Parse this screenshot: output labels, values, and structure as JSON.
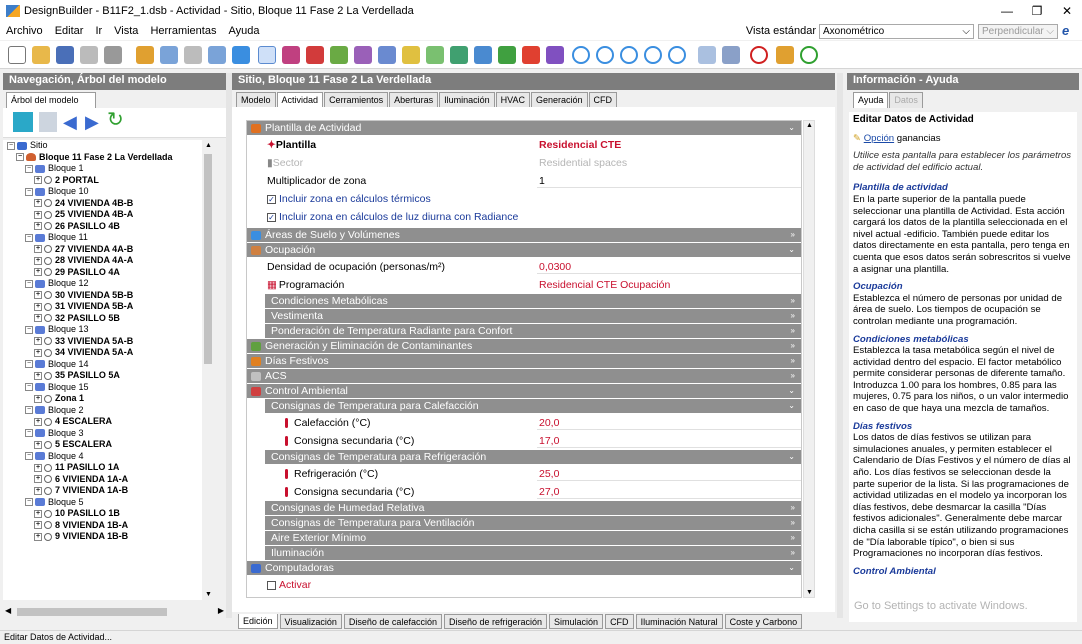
{
  "window": {
    "title": "DesignBuilder - B11F2_1.dsb - Actividad - Sitio, Bloque 11 Fase 2 La Verdellada"
  },
  "menu": {
    "items": [
      "Archivo",
      "Editar",
      "Ir",
      "Vista",
      "Herramientas",
      "Ayuda"
    ],
    "view_label": "Vista estándar",
    "view_mode": "Axonométrico",
    "view_direction": "Perpendicular"
  },
  "nav": {
    "title": "Navegación, Árbol del modelo",
    "tab": "Árbol del modelo",
    "tree": [
      {
        "label": "Sitio",
        "level": 0,
        "type": "site"
      },
      {
        "label": "Bloque 11 Fase 2 La Verdellada",
        "level": 1,
        "type": "building",
        "bold": true
      },
      {
        "label": "Bloque 1",
        "level": 2,
        "type": "block"
      },
      {
        "label": "2 PORTAL",
        "level": 3,
        "type": "zone",
        "bold": true
      },
      {
        "label": "Bloque 10",
        "level": 2,
        "type": "block"
      },
      {
        "label": "24 VIVIENDA 4B-B",
        "level": 3,
        "type": "zone",
        "bold": true
      },
      {
        "label": "25 VIVIENDA 4B-A",
        "level": 3,
        "type": "zone",
        "bold": true
      },
      {
        "label": "26 PASILLO 4B",
        "level": 3,
        "type": "zone",
        "bold": true
      },
      {
        "label": "Bloque 11",
        "level": 2,
        "type": "block"
      },
      {
        "label": "27 VIVIENDA 4A-B",
        "level": 3,
        "type": "zone",
        "bold": true
      },
      {
        "label": "28 VIVIENDA 4A-A",
        "level": 3,
        "type": "zone",
        "bold": true
      },
      {
        "label": "29 PASILLO 4A",
        "level": 3,
        "type": "zone",
        "bold": true
      },
      {
        "label": "Bloque 12",
        "level": 2,
        "type": "block"
      },
      {
        "label": "30 VIVIENDA 5B-B",
        "level": 3,
        "type": "zone",
        "bold": true
      },
      {
        "label": "31 VIVIENDA 5B-A",
        "level": 3,
        "type": "zone",
        "bold": true
      },
      {
        "label": "32 PASILLO 5B",
        "level": 3,
        "type": "zone",
        "bold": true
      },
      {
        "label": "Bloque 13",
        "level": 2,
        "type": "block"
      },
      {
        "label": "33 VIVIENDA 5A-B",
        "level": 3,
        "type": "zone",
        "bold": true
      },
      {
        "label": "34 VIVIENDA 5A-A",
        "level": 3,
        "type": "zone",
        "bold": true
      },
      {
        "label": "Bloque 14",
        "level": 2,
        "type": "block"
      },
      {
        "label": "35 PASILLO 5A",
        "level": 3,
        "type": "zone",
        "bold": true
      },
      {
        "label": "Bloque 15",
        "level": 2,
        "type": "block"
      },
      {
        "label": "Zona 1",
        "level": 3,
        "type": "zone",
        "bold": true
      },
      {
        "label": "Bloque 2",
        "level": 2,
        "type": "block"
      },
      {
        "label": "4 ESCALERA",
        "level": 3,
        "type": "zone",
        "bold": true
      },
      {
        "label": "Bloque 3",
        "level": 2,
        "type": "block"
      },
      {
        "label": "5 ESCALERA",
        "level": 3,
        "type": "zone",
        "bold": true
      },
      {
        "label": "Bloque 4",
        "level": 2,
        "type": "block"
      },
      {
        "label": "11 PASILLO 1A",
        "level": 3,
        "type": "zone",
        "bold": true
      },
      {
        "label": "6 VIVIENDA 1A-A",
        "level": 3,
        "type": "zone",
        "bold": true
      },
      {
        "label": "7 VIVIENDA 1A-B",
        "level": 3,
        "type": "zone",
        "bold": true
      },
      {
        "label": "Bloque 5",
        "level": 2,
        "type": "block"
      },
      {
        "label": "10 PASILLO 1B",
        "level": 3,
        "type": "zone",
        "bold": true
      },
      {
        "label": "8 VIVIENDA 1B-A",
        "level": 3,
        "type": "zone",
        "bold": true
      },
      {
        "label": "9 VIVIENDA 1B-B",
        "level": 3,
        "type": "zone",
        "bold": true
      }
    ]
  },
  "center": {
    "title": "Sitio, Bloque 11 Fase 2 La Verdellada",
    "tabs": [
      "Modelo",
      "Actividad",
      "Cerramientos",
      "Aberturas",
      "Iluminación",
      "HVAC",
      "Generación",
      "CFD"
    ],
    "active_tab": "Actividad",
    "template_section": "Plantilla de Actividad",
    "plantilla_label": "Plantilla",
    "plantilla_value": "Residencial CTE",
    "sector_label": "Sector",
    "sector_value": "Residential spaces",
    "multiplier_label": "Multiplicador de zona",
    "multiplier_value": "1",
    "include_thermal": "Incluir zona en cálculos térmicos",
    "include_daylight": "Incluir zona en cálculos de luz diurna con Radiance",
    "areas_section": "Áreas de Suelo y Volúmenes",
    "occupancy_section": "Ocupación",
    "density_label": "Densidad de ocupación (personas/m²)",
    "density_value": "0,0300",
    "schedule_label": "Programación",
    "schedule_value": "Residencial CTE Ocupación",
    "metabolic": "Condiciones Metabólicas",
    "clothing": "Vestimenta",
    "radiant": "Ponderación de Temperatura Radiante para Confort",
    "contaminants": "Generación y Eliminación de Contaminantes",
    "holidays": "Días Festivos",
    "acs": "ACS",
    "env_control": "Control Ambiental",
    "heating_setpoints": "Consignas de Temperatura para Calefacción",
    "heating_label": "Calefacción (°C)",
    "heating_value": "20,0",
    "heating_setback_label": "Consigna secundaria (°C)",
    "heating_setback_value": "17,0",
    "cooling_setpoints": "Consignas de Temperatura para Refrigeración",
    "cooling_label": "Refrigeración (°C)",
    "cooling_value": "25,0",
    "cooling_setback_label": "Consigna secundaria (°C)",
    "cooling_setback_value": "27,0",
    "humidity": "Consignas de Humedad Relativa",
    "ventilation": "Consignas de Temperatura para Ventilación",
    "min_air": "Aire Exterior Mínimo",
    "lighting": "Iluminación",
    "computers": "Computadoras",
    "activate": "Activar"
  },
  "bottom_tabs": [
    "Edición",
    "Visualización",
    "Diseño de calefacción",
    "Diseño de refrigeración",
    "Simulación",
    "CFD",
    "Iluminación Natural",
    "Coste y Carbono"
  ],
  "status": "Editar Datos de Actividad...",
  "info": {
    "title": "Información - Ayuda",
    "tabs": [
      "Ayuda",
      "Datos"
    ],
    "heading": "Editar Datos de Actividad",
    "option_link": "Opción",
    "option_rest": " ganancias",
    "intro": "Utilice esta pantalla para establecer los parámetros de actividad del edificio actual.",
    "s1_title": "Plantilla de actividad",
    "s1_text": "En la parte superior de la pantalla puede seleccionar una plantilla de Actividad. Esta acción cargará los datos de la plantilla seleccionada en el nivel actual -edificio. También puede editar los datos directamente en esta pantalla, pero tenga en cuenta que esos datos serán sobrescritos si vuelve a asignar una plantilla.",
    "s2_title": "Ocupación",
    "s2_text": "Establezca el número de personas por unidad de área de suelo. Los tiempos de ocupación se controlan mediante una programación.",
    "s3_title": "Condiciones metabólicas",
    "s3_text": "Establezca la tasa metabólica según el nivel de actividad dentro del espacio. El factor metabólico permite considerar personas de diferente tamaño. Introduzca 1.00 para los hombres, 0.85 para las mujeres, 0.75 para los niños, o un valor intermedio en caso de que haya una mezcla de tamaños.",
    "s4_title": "Días festivos",
    "s4_text": "Los datos de días festivos se utilizan para simulaciones anuales, y permiten establecer el Calendario de Días Festivos y el número de días al año. Los días festivos se seleccionan desde la parte superior de la lista. Si las programaciones de actividad utilizadas en el modelo ya incorporan los días festivos, debe desmarcar la casilla \"Días festivos adicionales\". Generalmente debe marcar dicha casilla si se están utilizando programaciones de \"Día laborable típico\", o bien si sus Programaciones no incorporan días festivos.",
    "s5_title": "Control Ambiental",
    "watermark": "Go to Settings to activate Windows."
  }
}
